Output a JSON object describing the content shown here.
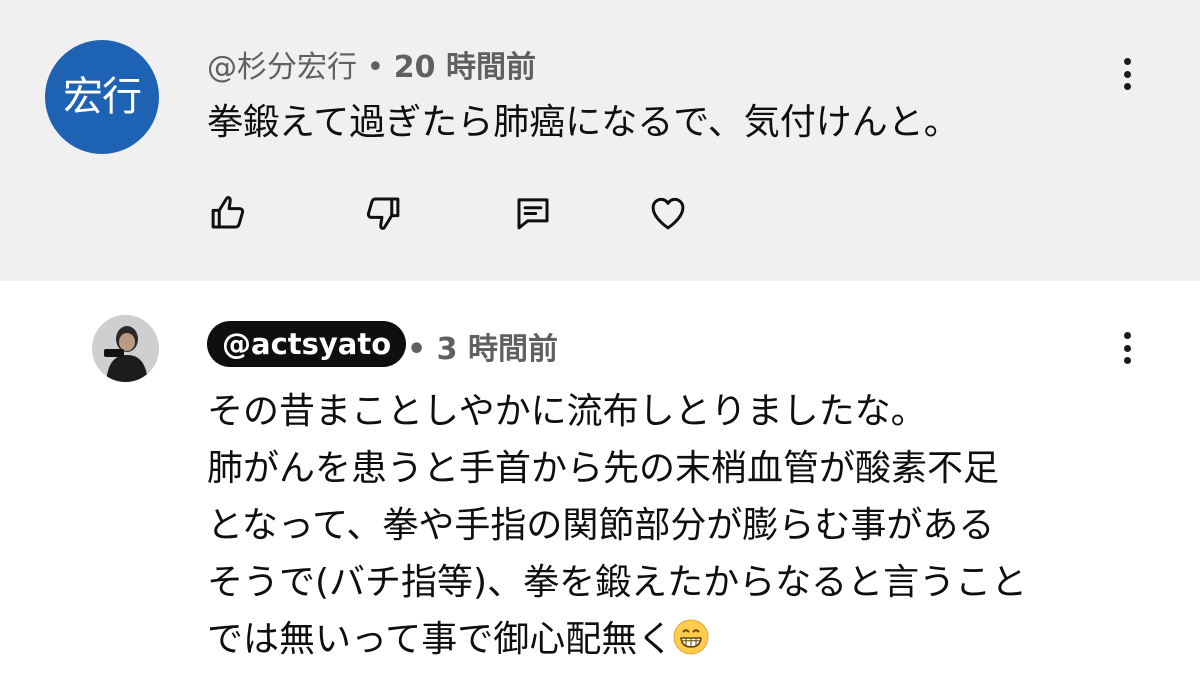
{
  "comment": {
    "avatar_text": "宏行",
    "author": "@杉分宏行",
    "separator": "•",
    "time": "20 時間前",
    "text": "拳鍛えて過ぎたら肺癌になるで、気付けんと。",
    "colors": {
      "background": "#f0f0f0",
      "avatar_bg": "#1e62b4"
    },
    "actions": [
      "like-icon",
      "dislike-icon",
      "reply-icon",
      "heart-icon"
    ]
  },
  "reply": {
    "author": "@actsyato",
    "separator": "•",
    "time": "3 時間前",
    "lines": [
      "その昔まことしやかに流布しとりましたな。",
      "肺がんを患うと手首から先の末梢血管が酸素不足",
      "となって、拳や手指の関節部分が膨らむ事がある",
      "そうで(バチ指等)、拳を鍛えたからなると言うこと",
      "では無いって事で御心配無く"
    ],
    "trailing_emoji": "grinning-face-icon",
    "colors": {
      "handle_pill": "#0f0f0f"
    }
  }
}
